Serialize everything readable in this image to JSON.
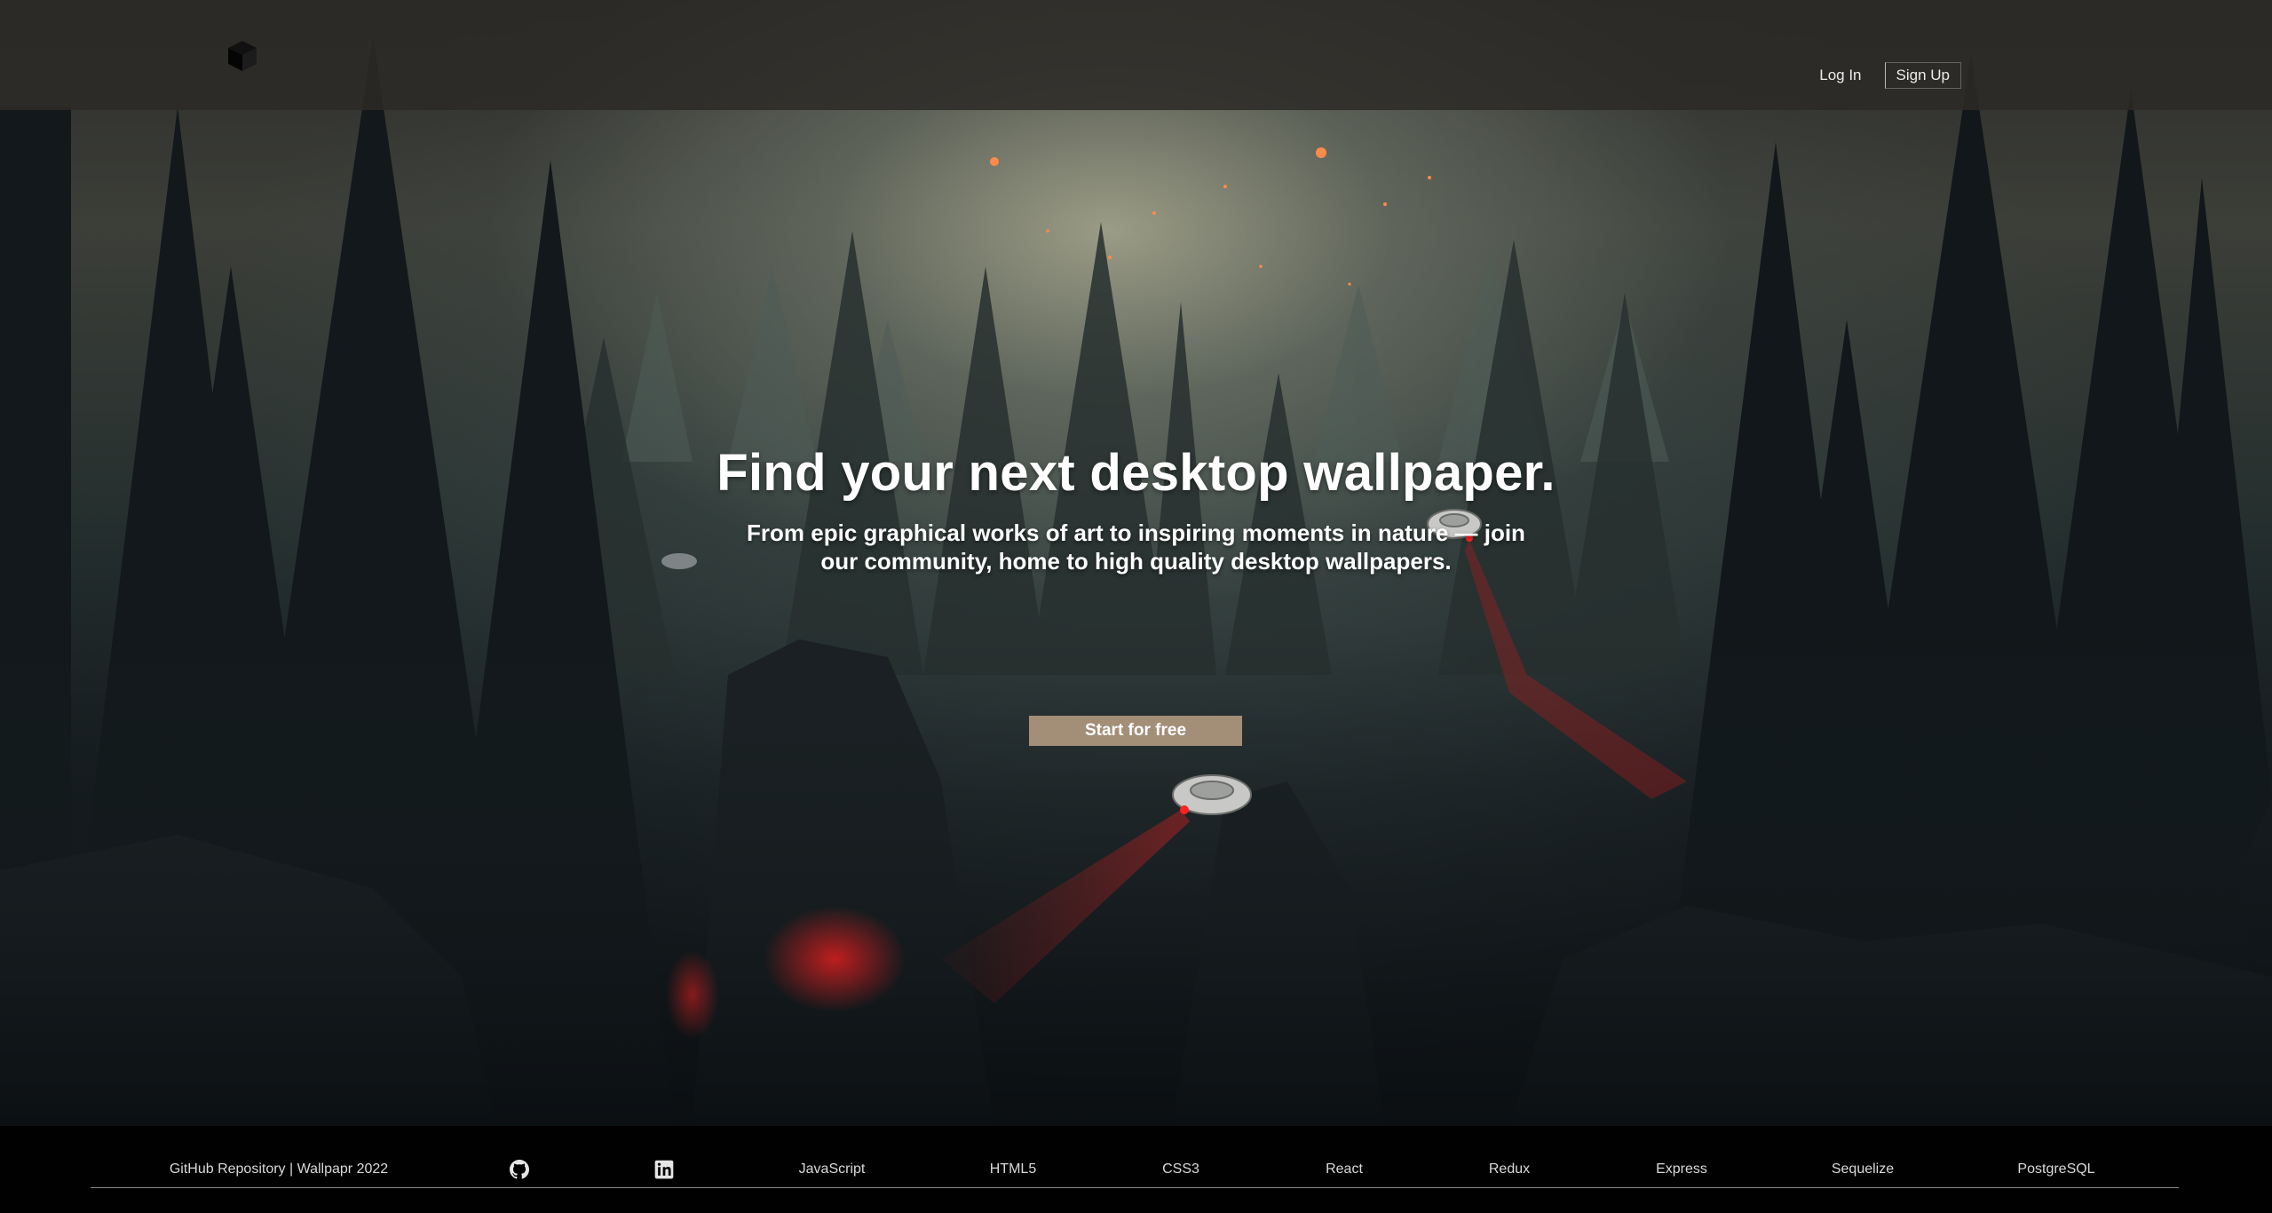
{
  "header": {
    "logo_icon": "cube-icon",
    "login_label": "Log In",
    "signup_label": "Sign Up"
  },
  "hero": {
    "title": "Find your next desktop wallpaper.",
    "subtitle": "From epic graphical works of art to inspiring moments in nature — join our community, home to high quality desktop wallpapers.",
    "cta_label": "Start for free",
    "cta_color": "#a38e78"
  },
  "footer": {
    "credit": "GitHub Repository | Wallpapr 2022",
    "icons": [
      "github-icon",
      "linkedin-icon"
    ],
    "tech": [
      "JavaScript",
      "HTML5",
      "CSS3",
      "React",
      "Redux",
      "Express",
      "Sequelize",
      "PostgreSQL"
    ]
  },
  "colors": {
    "header_bg": "#2c2a26",
    "footer_bg": "#010101",
    "accent_red": "#c8141c"
  }
}
